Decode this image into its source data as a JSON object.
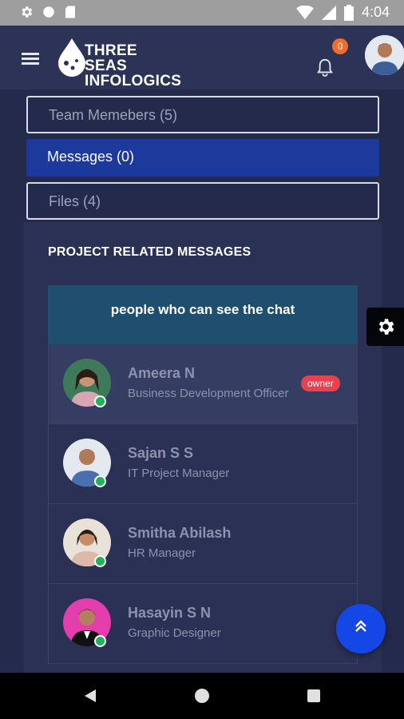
{
  "status_bar": {
    "time": "4:04",
    "icons": [
      "gear-icon",
      "circle-icon",
      "sd-card-icon",
      "wifi-icon",
      "signal-icon",
      "battery-icon"
    ]
  },
  "header": {
    "logo_line1": "THREE SEAS",
    "logo_line2": "INFOLOGICS",
    "notification_count": "0"
  },
  "tabs": [
    {
      "label": "Team Memebers (5)",
      "active": false
    },
    {
      "label": "Messages (0)",
      "active": true
    },
    {
      "label": "Files (4)",
      "active": false
    }
  ],
  "section": {
    "title": "PROJECT RELATED MESSAGES",
    "card_header": "people who can see the chat"
  },
  "members": [
    {
      "name": "Ameera N",
      "role": "Business Development Officer",
      "badge": "owner",
      "online": true
    },
    {
      "name": "Sajan S S",
      "role": "IT Project Manager",
      "online": true
    },
    {
      "name": "Smitha Abilash",
      "role": "HR Manager",
      "online": true
    },
    {
      "name": "Hasayin S N",
      "role": "Graphic Designer",
      "online": true
    }
  ],
  "colors": {
    "background": "#232a4c",
    "header": "#2c3356",
    "active_tab": "#1c3a9b",
    "card_header": "#1f4e6e",
    "owner_badge": "#e8414f",
    "notification_badge": "#ef6c2e",
    "online": "#21b35a",
    "fab": "#1447e6"
  }
}
